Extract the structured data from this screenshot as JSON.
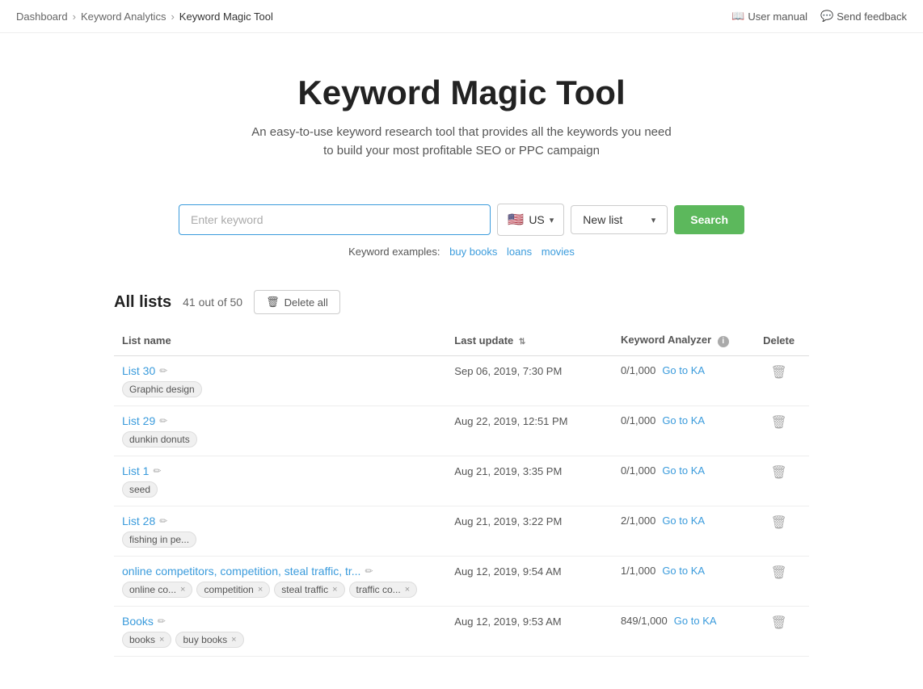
{
  "breadcrumb": {
    "items": [
      {
        "label": "Dashboard",
        "url": "#"
      },
      {
        "label": "Keyword Analytics",
        "url": "#"
      },
      {
        "label": "Keyword Magic Tool"
      }
    ],
    "right_links": [
      {
        "label": "User manual",
        "icon": "book-icon"
      },
      {
        "label": "Send feedback",
        "icon": "comment-icon"
      }
    ]
  },
  "hero": {
    "title": "Keyword Magic Tool",
    "subtitle": "An easy-to-use keyword research tool that provides all the keywords you need\nto build your most profitable SEO or PPC campaign"
  },
  "search": {
    "input_placeholder": "Enter keyword",
    "country_label": "US",
    "country_flag": "🇺🇸",
    "list_label": "New list",
    "search_button": "Search",
    "examples_label": "Keyword examples:",
    "examples": [
      "buy books",
      "loans",
      "movies"
    ]
  },
  "all_lists": {
    "title": "All lists",
    "count": "41 out of 50",
    "delete_all_label": "Delete all",
    "columns": {
      "name": "List name",
      "update": "Last update",
      "ka": "Keyword Analyzer",
      "delete": "Delete"
    },
    "rows": [
      {
        "name": "List 30",
        "tags": [
          {
            "label": "Graphic design",
            "removable": false
          }
        ],
        "update": "Sep 06, 2019, 7:30 PM",
        "ka_ratio": "0/1,000",
        "go_ka": "Go to KA"
      },
      {
        "name": "List 29",
        "tags": [
          {
            "label": "dunkin donuts",
            "removable": false
          }
        ],
        "update": "Aug 22, 2019, 12:51 PM",
        "ka_ratio": "0/1,000",
        "go_ka": "Go to KA"
      },
      {
        "name": "List 1",
        "tags": [
          {
            "label": "seed",
            "removable": false
          }
        ],
        "update": "Aug 21, 2019, 3:35 PM",
        "ka_ratio": "0/1,000",
        "go_ka": "Go to KA"
      },
      {
        "name": "List 28",
        "tags": [
          {
            "label": "fishing in pe...",
            "removable": false
          }
        ],
        "update": "Aug 21, 2019, 3:22 PM",
        "ka_ratio": "2/1,000",
        "go_ka": "Go to KA"
      },
      {
        "name": "online competitors, competition, steal traffic, tr...",
        "has_edit": true,
        "tags": [
          {
            "label": "online co...",
            "removable": true
          },
          {
            "label": "competition",
            "removable": true
          },
          {
            "label": "steal traffic",
            "removable": true
          },
          {
            "label": "traffic co...",
            "removable": true
          }
        ],
        "update": "Aug 12, 2019, 9:54 AM",
        "ka_ratio": "1/1,000",
        "go_ka": "Go to KA"
      },
      {
        "name": "Books",
        "has_badge": true,
        "tags": [
          {
            "label": "books",
            "removable": true
          },
          {
            "label": "buy books",
            "removable": true
          }
        ],
        "update": "Aug 12, 2019, 9:53 AM",
        "ka_ratio": "849/1,000",
        "go_ka": "Go to KA"
      }
    ]
  }
}
